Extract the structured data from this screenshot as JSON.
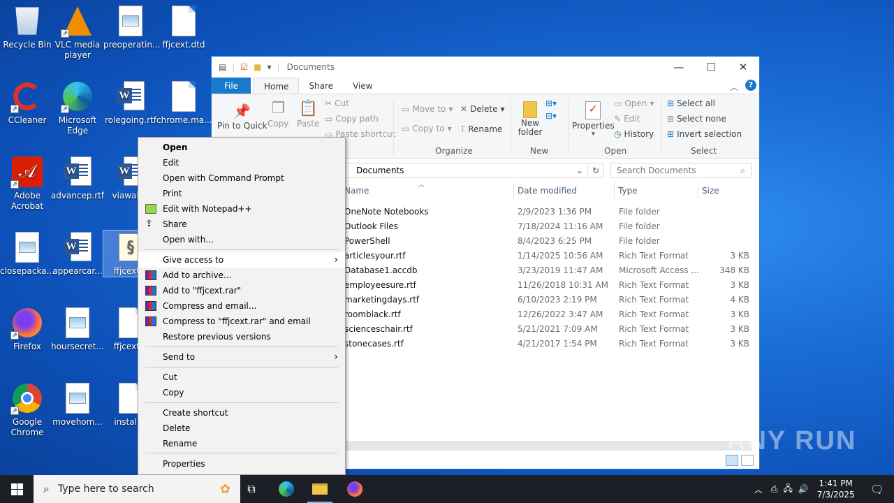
{
  "desktop": {
    "icons": [
      {
        "label": "Recycle Bin",
        "icon": "recycle-bin-icon"
      },
      {
        "label": "VLC media player",
        "icon": "vlc-icon"
      },
      {
        "label": "preoperatin...",
        "icon": "image-file-icon"
      },
      {
        "label": "ffjcext.dtd",
        "icon": "blank-file-icon"
      },
      {
        "label": "CCleaner",
        "icon": "ccleaner-icon"
      },
      {
        "label": "Microsoft Edge",
        "icon": "edge-icon"
      },
      {
        "label": "rolegoing.rtf",
        "icon": "word-doc-icon"
      },
      {
        "label": "chrome.ma...",
        "icon": "blank-file-icon"
      },
      {
        "label": "Adobe Acrobat",
        "icon": "acrobat-icon"
      },
      {
        "label": "advancep.rtf",
        "icon": "word-doc-icon"
      },
      {
        "label": "viawall...",
        "icon": "word-doc-icon"
      },
      {
        "label": "closepacka...",
        "icon": "image-file-icon"
      },
      {
        "label": "appearcar...",
        "icon": "word-doc-icon"
      },
      {
        "label": "ffjcext...",
        "icon": "script-file-icon"
      },
      {
        "label": "Firefox",
        "icon": "firefox-icon"
      },
      {
        "label": "hoursecret...",
        "icon": "image-file-icon"
      },
      {
        "label": "ffjcext...",
        "icon": "blank-file-icon"
      },
      {
        "label": "Google Chrome",
        "icon": "chrome-icon"
      },
      {
        "label": "movehom...",
        "icon": "image-file-icon"
      },
      {
        "label": "install...",
        "icon": "blank-file-icon"
      }
    ]
  },
  "explorer": {
    "title": "Documents",
    "tabs": [
      "File",
      "Home",
      "Share",
      "View"
    ],
    "ribbon": {
      "clipboard": {
        "pin": "Pin to Quick",
        "copy": "Copy",
        "paste": "Paste",
        "cut": "Cut",
        "copy_path": "Copy path",
        "paste_shortcut": "Paste shortcut"
      },
      "organize": {
        "label": "Organize",
        "move_to": "Move to",
        "copy_to": "Copy to",
        "delete": "Delete",
        "rename": "Rename"
      },
      "new": {
        "label": "New",
        "new_folder": "New folder"
      },
      "open": {
        "label": "Open",
        "properties": "Properties",
        "open": "Open",
        "edit": "Edit",
        "history": "History"
      },
      "select": {
        "label": "Select",
        "select_all": "Select all",
        "select_none": "Select none",
        "invert": "Invert selection"
      }
    },
    "address": "Documents",
    "search_placeholder": "Search Documents",
    "columns": {
      "name": "Name",
      "date": "Date modified",
      "type": "Type",
      "size": "Size"
    },
    "files": [
      {
        "name": "OneNote Notebooks",
        "date": "2/9/2023 1:36 PM",
        "type": "File folder",
        "size": ""
      },
      {
        "name": "Outlook Files",
        "date": "7/18/2024 11:16 AM",
        "type": "File folder",
        "size": ""
      },
      {
        "name": "PowerShell",
        "date": "8/4/2023 6:25 PM",
        "type": "File folder",
        "size": ""
      },
      {
        "name": "articlesyour.rtf",
        "date": "1/14/2025 10:56 AM",
        "type": "Rich Text Format",
        "size": "3 KB"
      },
      {
        "name": "Database1.accdb",
        "date": "3/23/2019 11:47 AM",
        "type": "Microsoft Access ...",
        "size": "348 KB"
      },
      {
        "name": "employeesure.rtf",
        "date": "11/26/2018 10:31 AM",
        "type": "Rich Text Format",
        "size": "3 KB"
      },
      {
        "name": "marketingdays.rtf",
        "date": "6/10/2023 2:19 PM",
        "type": "Rich Text Format",
        "size": "4 KB"
      },
      {
        "name": "roomblack.rtf",
        "date": "12/26/2022 3:47 AM",
        "type": "Rich Text Format",
        "size": "3 KB"
      },
      {
        "name": "scienceschair.rtf",
        "date": "5/21/2021 7:09 AM",
        "type": "Rich Text Format",
        "size": "3 KB"
      },
      {
        "name": "stonecases.rtf",
        "date": "4/21/2017 1:54 PM",
        "type": "Rich Text Format",
        "size": "3 KB"
      }
    ]
  },
  "context_menu": {
    "items": [
      {
        "label": "Open",
        "bold": true
      },
      {
        "label": "Edit"
      },
      {
        "label": "Open with Command Prompt"
      },
      {
        "label": "Print"
      },
      {
        "label": "Edit with Notepad++",
        "icon": "notepadpp-icon"
      },
      {
        "label": "Share",
        "icon": "share-icon"
      },
      {
        "label": "Open with..."
      },
      {
        "label": "Give access to",
        "submenu": true,
        "highlighted": true
      },
      {
        "label": "Add to archive...",
        "icon": "winrar-icon"
      },
      {
        "label": "Add to \"ffjcext.rar\"",
        "icon": "winrar-icon"
      },
      {
        "label": "Compress and email...",
        "icon": "winrar-icon"
      },
      {
        "label": "Compress to \"ffjcext.rar\" and email",
        "icon": "winrar-icon"
      },
      {
        "label": "Restore previous versions"
      },
      {
        "label": "Send to",
        "submenu": true
      },
      {
        "label": "Cut"
      },
      {
        "label": "Copy"
      },
      {
        "label": "Create shortcut"
      },
      {
        "label": "Delete"
      },
      {
        "label": "Rename"
      },
      {
        "label": "Properties"
      }
    ]
  },
  "taskbar": {
    "search_placeholder": "Type here to search",
    "time": "1:41 PM",
    "date": "7/3/2025"
  },
  "watermark": "ANY RUN"
}
